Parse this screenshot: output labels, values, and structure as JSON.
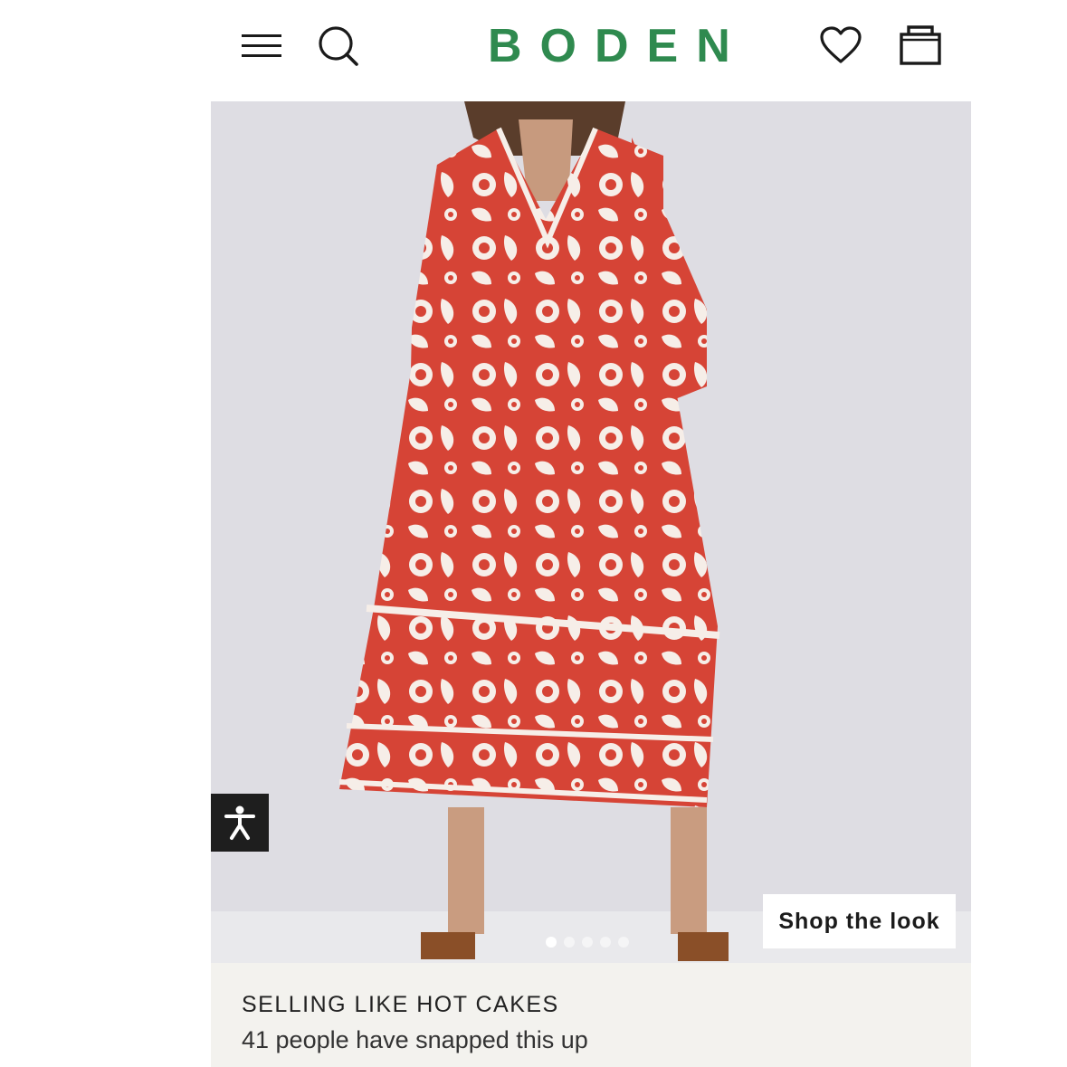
{
  "header": {
    "brand": "BODEN",
    "brand_color": "#2f8a4f",
    "icons": [
      "menu-icon",
      "search-icon",
      "heart-icon",
      "shopping-bag-icon"
    ]
  },
  "hero": {
    "shop_button_label": "Shop the look",
    "carousel_total_slides": 5,
    "carousel_active_index": 0,
    "accessibility_icon": "accessibility-icon",
    "dress_color": "#d64436"
  },
  "promo": {
    "title": "SELLING LIKE HOT CAKES",
    "subtitle": "41 people have snapped this up"
  }
}
